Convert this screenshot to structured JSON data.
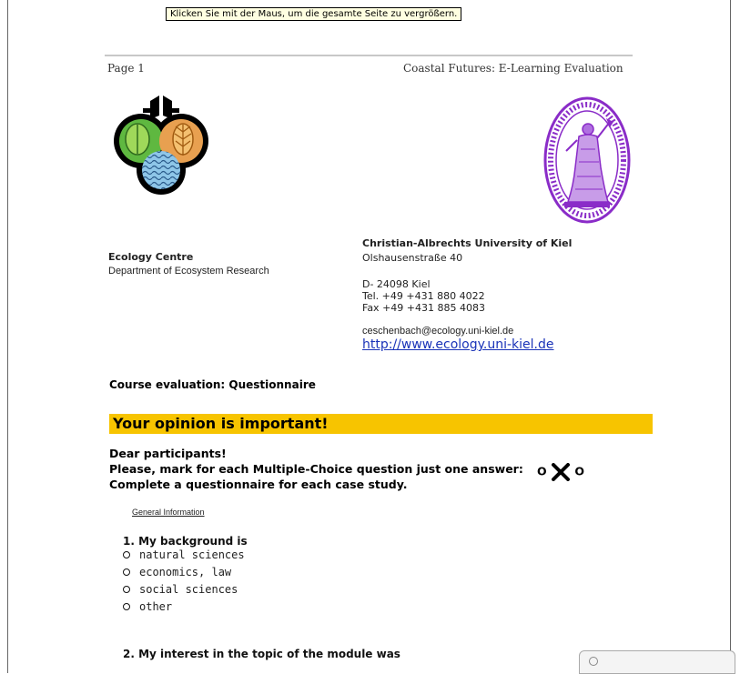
{
  "tooltip": {
    "text": "Klicken Sie mit der Maus, um die gesamte Seite zu vergrößern."
  },
  "header": {
    "page": "Page 1",
    "title": "Coastal Futures: E-Learning Evaluation"
  },
  "left_org": {
    "name": "Ecology Centre",
    "department": "Department of Ecosystem Research"
  },
  "right_org": {
    "name": "Christian-Albrechts University of Kiel",
    "street": "Olshausenstraße 40",
    "city": "D- 24098 Kiel",
    "tel": "Tel. +49 +431 880 4022",
    "fax": "Fax +49 +431 885 4083",
    "email": "ceschenbach@ecology.uni-kiel.de",
    "url": "http://www.ecology.uni-kiel.de"
  },
  "course_evaluation": "Course evaluation: Questionnaire",
  "banner": "Your opinion is important!",
  "intro": {
    "greeting": "Dear participants!",
    "instruction": "Please, mark for each Multiple-Choice question just one answer:",
    "mark_left": "O",
    "mark_right": "O",
    "complete": "Complete a questionnaire for each case study."
  },
  "section_label": "General Information",
  "questions": [
    {
      "title": "1.  My background is",
      "options": [
        "natural sciences",
        "economics, law",
        "social sciences",
        "other"
      ]
    },
    {
      "title": "2.  My interest in the topic of the module was",
      "options": []
    }
  ],
  "colors": {
    "banner": "#f7c400",
    "link": "#1a33b8",
    "seal": "#8a2cc8"
  },
  "icons": {
    "ecology_logo": "ecology-centre-logo",
    "seal": "university-seal",
    "mark": "cross-mark-icon"
  }
}
